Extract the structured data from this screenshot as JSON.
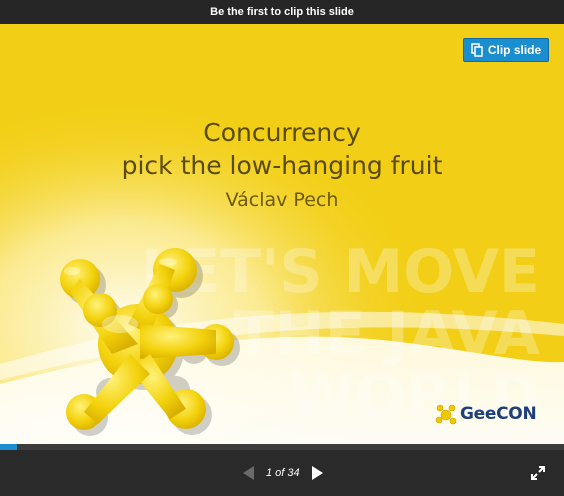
{
  "topbar": {
    "text": "Be the first to clip this slide"
  },
  "clip_button": {
    "label": "Clip slide",
    "icon": "clip-icon"
  },
  "slide": {
    "title_line1": "Concurrency",
    "title_line2": "pick the low-hanging fruit",
    "author": "Václav Pech",
    "watermark_lines": [
      "LET'S MOVE",
      "THE JAVA",
      "WORLD"
    ],
    "logo_text": "GeeCON",
    "background_color": "#f2cf16"
  },
  "player": {
    "counter": "1 of 34",
    "current_page": 1,
    "total_pages": 34,
    "progress_fraction": 0.03,
    "prev_icon": "prev-arrow-icon",
    "next_icon": "next-arrow-icon",
    "fullscreen_icon": "expand-icon",
    "accent_color": "#1b8ed0"
  }
}
